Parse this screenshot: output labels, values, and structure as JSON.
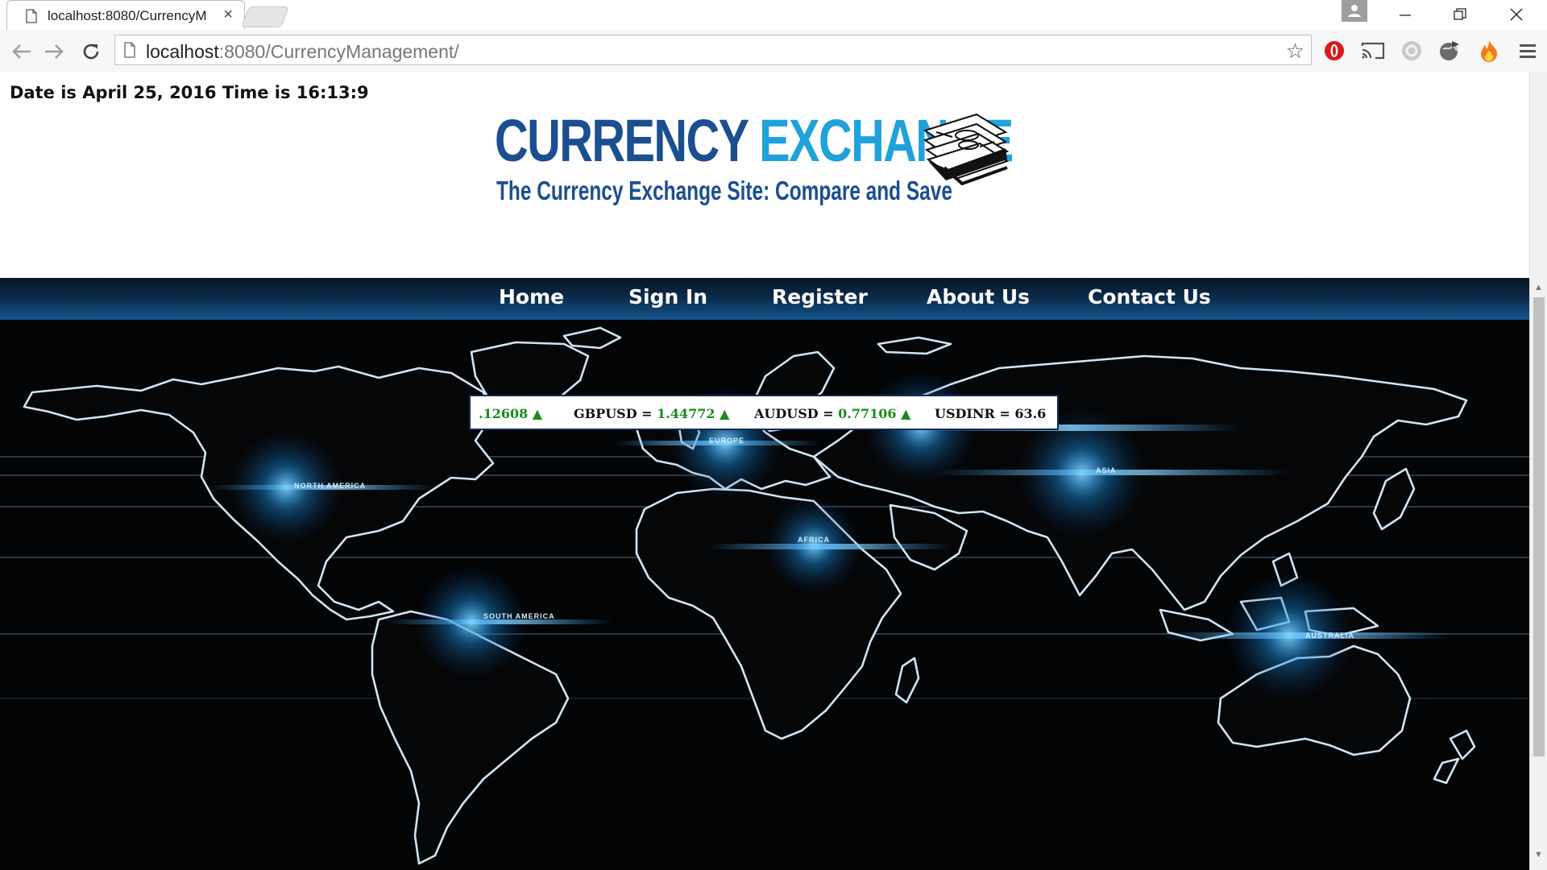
{
  "browser": {
    "tab_title": "localhost:8080/CurrencyM",
    "url_host": "localhost",
    "url_rest": ":8080/CurrencyManagement/"
  },
  "page": {
    "datetime": "Date is April 25, 2016 Time is 16:13:9",
    "logo": {
      "word1": "CURRENCY",
      "word2": "EXCHANGE",
      "tagline": "The Currency Exchange Site: Compare and Save"
    },
    "nav": [
      "Home",
      "Sign In",
      "Register",
      "About Us",
      "Contact Us"
    ],
    "ticker": [
      {
        "symbol": "",
        "value": ".12608 ▲"
      },
      {
        "symbol": "GBPUSD = ",
        "value": "1.44772 ▲"
      },
      {
        "symbol": "AUDUSD = ",
        "value": "0.77106 ▲"
      },
      {
        "symbol": "USDINR = ",
        "value": "63.6"
      }
    ],
    "map_labels": [
      "NORTH AMERICA",
      "EUROPE",
      "ASIA",
      "AFRICA",
      "SOUTH AMERICA",
      "AUSTRALIA"
    ]
  },
  "colors": {
    "brand_dark": "#1b4f8f",
    "brand_light": "#1fa2dc",
    "ticker_up": "#1a8a1a",
    "nav_bg": "#0c2a48"
  }
}
